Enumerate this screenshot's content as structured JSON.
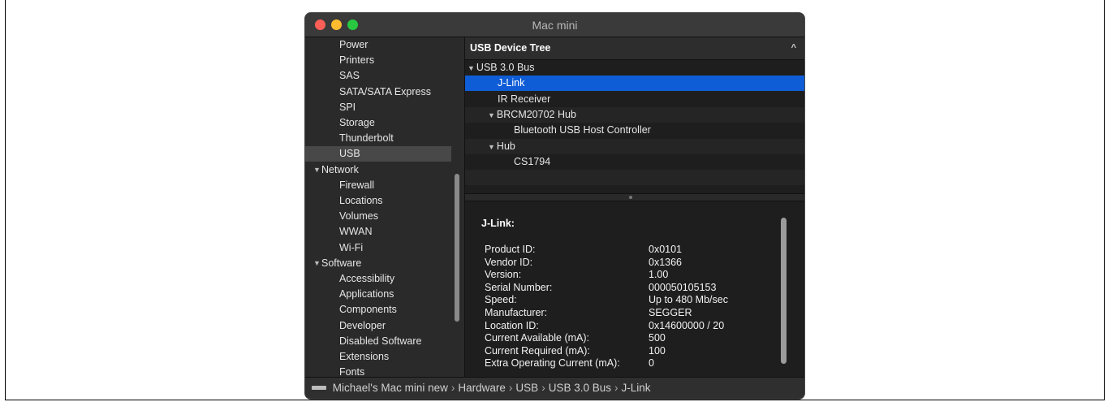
{
  "window": {
    "title": "Mac mini"
  },
  "sidebar": {
    "items": [
      {
        "label": "Power",
        "type": "item",
        "selected": false
      },
      {
        "label": "Printers",
        "type": "item",
        "selected": false
      },
      {
        "label": "SAS",
        "type": "item",
        "selected": false
      },
      {
        "label": "SATA/SATA Express",
        "type": "item",
        "selected": false
      },
      {
        "label": "SPI",
        "type": "item",
        "selected": false
      },
      {
        "label": "Storage",
        "type": "item",
        "selected": false
      },
      {
        "label": "Thunderbolt",
        "type": "item",
        "selected": false
      },
      {
        "label": "USB",
        "type": "item",
        "selected": true
      },
      {
        "label": "Network",
        "type": "category",
        "selected": false
      },
      {
        "label": "Firewall",
        "type": "item",
        "selected": false
      },
      {
        "label": "Locations",
        "type": "item",
        "selected": false
      },
      {
        "label": "Volumes",
        "type": "item",
        "selected": false
      },
      {
        "label": "WWAN",
        "type": "item",
        "selected": false
      },
      {
        "label": "Wi-Fi",
        "type": "item",
        "selected": false
      },
      {
        "label": "Software",
        "type": "category",
        "selected": false
      },
      {
        "label": "Accessibility",
        "type": "item",
        "selected": false
      },
      {
        "label": "Applications",
        "type": "item",
        "selected": false
      },
      {
        "label": "Components",
        "type": "item",
        "selected": false
      },
      {
        "label": "Developer",
        "type": "item",
        "selected": false
      },
      {
        "label": "Disabled Software",
        "type": "item",
        "selected": false
      },
      {
        "label": "Extensions",
        "type": "item",
        "selected": false
      },
      {
        "label": "Fonts",
        "type": "item",
        "selected": false
      }
    ]
  },
  "tree": {
    "header": "USB Device Tree",
    "rows": [
      {
        "label": "USB 3.0 Bus",
        "level": 0,
        "expanded": true,
        "selected": false
      },
      {
        "label": "J-Link",
        "level": 1,
        "expanded": false,
        "selected": true
      },
      {
        "label": "IR Receiver",
        "level": 1,
        "expanded": false,
        "selected": false
      },
      {
        "label": "BRCM20702 Hub",
        "level": 1,
        "expanded": true,
        "selected": false
      },
      {
        "label": "Bluetooth USB Host Controller",
        "level": 2,
        "expanded": false,
        "selected": false
      },
      {
        "label": "Hub",
        "level": 1,
        "expanded": true,
        "selected": false
      },
      {
        "label": "CS1794",
        "level": 2,
        "expanded": false,
        "selected": false
      }
    ]
  },
  "detail": {
    "title": "J-Link:",
    "rows": [
      {
        "key": "Product ID:",
        "value": "0x0101"
      },
      {
        "key": "Vendor ID:",
        "value": "0x1366"
      },
      {
        "key": "Version:",
        "value": "1.00"
      },
      {
        "key": "Serial Number:",
        "value": "000050105153"
      },
      {
        "key": "Speed:",
        "value": "Up to 480 Mb/sec"
      },
      {
        "key": "Manufacturer:",
        "value": "SEGGER"
      },
      {
        "key": "Location ID:",
        "value": "0x14600000 / 20"
      },
      {
        "key": "Current Available (mA):",
        "value": "500"
      },
      {
        "key": "Current Required (mA):",
        "value": "100"
      },
      {
        "key": "Extra Operating Current (mA):",
        "value": "0"
      }
    ]
  },
  "pathbar": {
    "crumbs": [
      "Michael's Mac mini new",
      "Hardware",
      "USB",
      "USB 3.0 Bus",
      "J-Link"
    ],
    "separator": "›"
  },
  "icons": {
    "disclosure": "▼",
    "collapse": "^"
  },
  "colors": {
    "selection": "#0f5dd6",
    "close": "#fe5f57",
    "minimize": "#febc2e",
    "zoom": "#28c840"
  }
}
